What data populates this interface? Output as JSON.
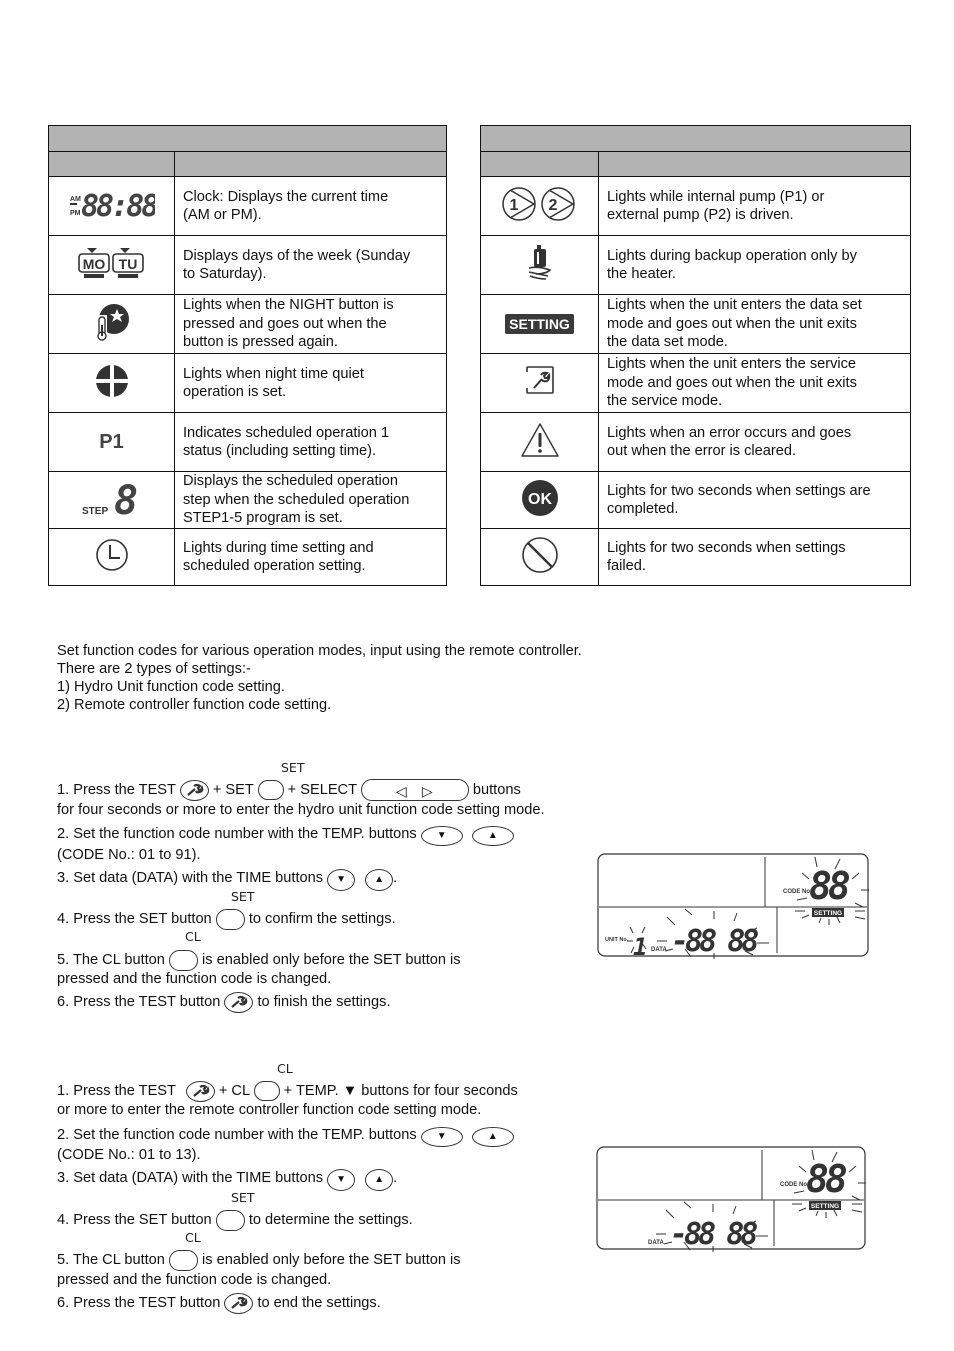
{
  "left_table": {
    "header": "",
    "col_headers": [
      "",
      ""
    ],
    "rows": [
      {
        "icon": "clock-display-icon",
        "icon_text": {
          "am": "AM",
          "pm": "PM",
          "digits": "88:88"
        },
        "desc_lines": [
          "Clock: Displays the current time",
          "(AM or PM)."
        ]
      },
      {
        "icon": "day-of-week-icon",
        "icon_text": {
          "d1": "MO",
          "d2": "TU"
        },
        "desc_lines": [
          "Displays days of the week (Sunday",
          "to Saturday)."
        ]
      },
      {
        "icon": "night-mode-icon",
        "desc_lines": [
          "Lights when the NIGHT button is",
          "pressed and goes out when the",
          "button is pressed again."
        ]
      },
      {
        "icon": "quiet-operation-icon",
        "desc_lines": [
          "Lights when night time quiet",
          "operation is set."
        ]
      },
      {
        "icon": "program-p1-icon",
        "icon_text": {
          "label": "P1"
        },
        "desc_lines": [
          "Indicates scheduled operation 1",
          "status (including setting time)."
        ]
      },
      {
        "icon": "step-indicator-icon",
        "icon_text": {
          "label": "STEP",
          "digit": "8"
        },
        "desc_lines": [
          "Displays the scheduled operation",
          "step when the scheduled operation",
          "STEP1-5 program is set."
        ]
      },
      {
        "icon": "clock-icon",
        "desc_lines": [
          "Lights during time setting and",
          "scheduled operation setting."
        ]
      }
    ]
  },
  "right_table": {
    "header": "",
    "col_headers": [
      "",
      ""
    ],
    "rows": [
      {
        "icon": "pump-icon",
        "icon_text": {
          "p1": "1",
          "p2": "2"
        },
        "desc_lines": [
          "Lights while internal pump (P1) or",
          "external pump (P2) is driven."
        ]
      },
      {
        "icon": "backup-heater-icon",
        "desc_lines": [
          "Lights during backup operation only by",
          "the heater."
        ]
      },
      {
        "icon": "setting-badge-icon",
        "icon_text": {
          "label": "SETTING"
        },
        "desc_lines": [
          "Lights when the unit enters the data set",
          "mode and goes out when the unit exits",
          "the data set mode."
        ]
      },
      {
        "icon": "service-wrench-icon",
        "desc_lines": [
          "Lights when the unit enters the service",
          "mode and goes out when the unit exits",
          "the service mode."
        ]
      },
      {
        "icon": "warning-icon",
        "desc_lines": [
          "Lights when an error occurs and goes",
          "out when the error is cleared."
        ]
      },
      {
        "icon": "ok-icon",
        "icon_text": {
          "label": "OK"
        },
        "desc_lines": [
          "Lights for two seconds when settings are",
          "completed."
        ]
      },
      {
        "icon": "prohibited-icon",
        "desc_lines": [
          "Lights for two seconds when settings",
          "failed."
        ]
      }
    ]
  },
  "intro": {
    "lines": [
      "Set function codes for various operation modes, input using the remote controller.",
      "There are 2 types of settings:-",
      "1) Hydro Unit function code setting.",
      "2) Remote controller function code setting."
    ]
  },
  "hydro_section": {
    "step1": {
      "pre": " 1. Press the TEST",
      "plus_set": "+ SET",
      "plus_select": "+ SELECT",
      "post": "buttons",
      "set_label": "SET",
      "line2": "for four seconds or more to enter the hydro unit function code setting mode."
    },
    "step2": {
      "text": "2. Set the function code number with the TEMP. buttons",
      "line2": "(CODE No.: 01 to 91)."
    },
    "step3": {
      "text": "3. Set data (DATA) with the TIME buttons",
      "post": "."
    },
    "step4": {
      "pre": "4. Press the SET button",
      "post": "to confirm the settings.",
      "label": "SET"
    },
    "step5": {
      "pre": "5. The CL button",
      "post": "is enabled only before the SET button is",
      "line2": "pressed and the function code is changed.",
      "label": "CL"
    },
    "step6": {
      "pre": "6. Press the TEST button",
      "post": "to finish the settings."
    },
    "lcd": {
      "code_label": "CODE No.",
      "code_digits": "88",
      "setting": "SETTING",
      "unit_label": "UNIT No.",
      "unit_digit": "1",
      "data_label": "DATA",
      "data_digits": "-88 88"
    }
  },
  "remote_section": {
    "step1": {
      "pre": " 1. Press the TEST",
      "plus_cl": "+ CL",
      "post": "+ TEMP. ▼ buttons for four seconds",
      "cl_label": "CL",
      "line2": " or more to enter the remote controller function code setting mode."
    },
    "step2": {
      "text": "2. Set the function code number with the TEMP. buttons",
      "line2": " (CODE No.: 01 to 13)."
    },
    "step3": {
      "text": "3. Set data (DATA) with the TIME buttons",
      "post": "."
    },
    "step4": {
      "pre": "4. Press the SET button",
      "post": "to determine the settings.",
      "label": "SET"
    },
    "step5": {
      "pre": "5. The CL button",
      "post": "is enabled only before the SET button is",
      "line2": "pressed and the function code is changed.",
      "label": "CL"
    },
    "step6": {
      "pre": "6. Press the TEST button",
      "post": "to end the settings."
    },
    "lcd": {
      "code_label": "CODE No.",
      "code_digits": "88",
      "setting": "SETTING",
      "data_label": "DATA",
      "data_digits": "-88 88"
    }
  },
  "colors": {
    "header_gray": "#b3b3b3",
    "border": "#111111",
    "icon_dark": "#333333"
  }
}
